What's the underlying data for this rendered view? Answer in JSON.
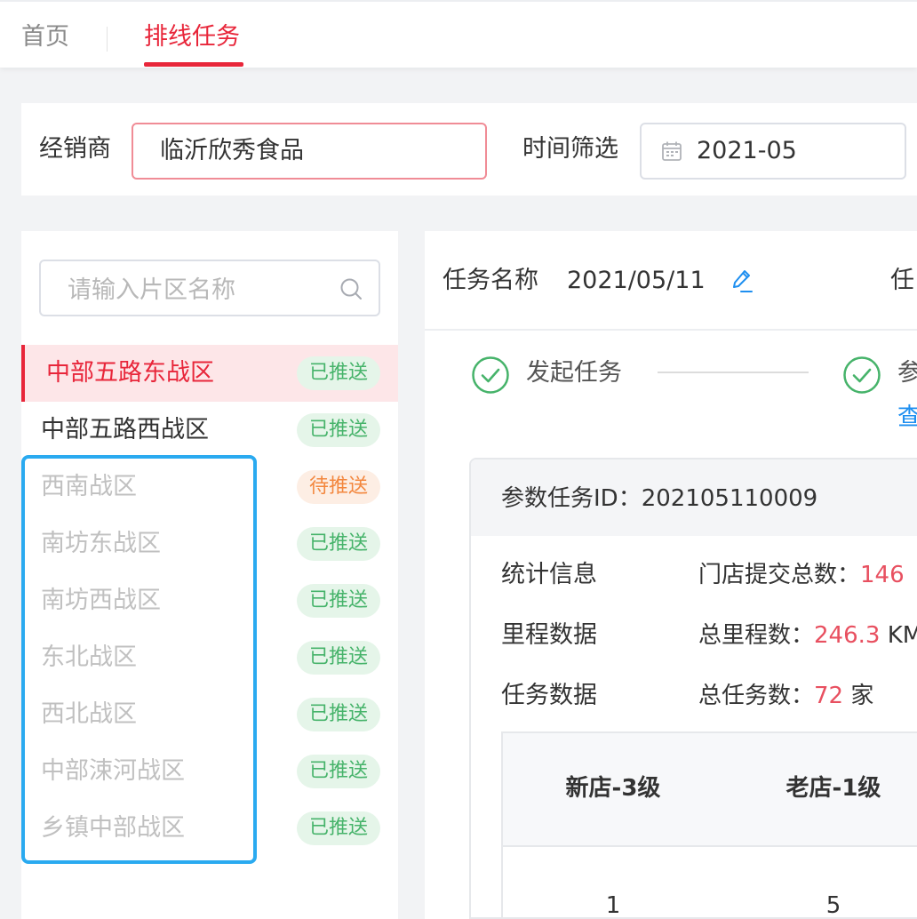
{
  "tabs": {
    "home": "首页",
    "task": "排线任务"
  },
  "filter": {
    "dealer_label": "经销商",
    "dealer_value": "临沂欣秀食品",
    "time_label": "时间筛选",
    "time_value": "2021-05"
  },
  "search": {
    "placeholder": "请输入片区名称"
  },
  "zones": [
    {
      "name": "中部五路东战区",
      "status": "已推送"
    },
    {
      "name": "中部五路西战区",
      "status": "已推送"
    },
    {
      "name": "西南战区",
      "status": "待推送"
    },
    {
      "name": "南坊东战区",
      "status": "已推送"
    },
    {
      "name": "南坊西战区",
      "status": "已推送"
    },
    {
      "name": "东北战区",
      "status": "已推送"
    },
    {
      "name": "西北战区",
      "status": "已推送"
    },
    {
      "name": "中部涑河战区",
      "status": "已推送"
    },
    {
      "name": "乡镇中部战区",
      "status": "已推送"
    }
  ],
  "task": {
    "name_label": "任务名称",
    "name_value": "2021/05/11",
    "second_label_partial": "任"
  },
  "steps": {
    "step1": "发起任务",
    "step2_partial": "参",
    "step2_link_partial": "查"
  },
  "card": {
    "id_text": "参数任务ID：202105110009",
    "rows": [
      {
        "label": "统计信息",
        "key": "门店提交总数：",
        "value": "146",
        "unit": ""
      },
      {
        "label": "里程数据",
        "key": "总里程数：",
        "value": "246.3",
        "unit": " KM"
      },
      {
        "label": "任务数据",
        "key": "总任务数：",
        "value": "72",
        "unit": " 家"
      }
    ],
    "table": {
      "headers": [
        "新店-3级",
        "老店-1级"
      ],
      "row": [
        "1",
        "5"
      ]
    }
  },
  "colors": {
    "accent_red": "#e8263a",
    "pushed_green": "#46b36a",
    "pending_orange": "#f3873e",
    "highlight_blue": "#2aaaf0",
    "link_blue": "#1e8ff0"
  }
}
